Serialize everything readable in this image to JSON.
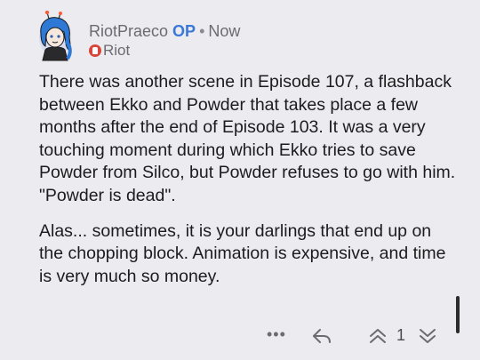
{
  "comment": {
    "author": "RiotPraeco",
    "op_badge": "OP",
    "separator": "•",
    "timestamp": "Now",
    "flair": "Riot",
    "paragraphs": [
      "There was another scene in Episode 107, a flashback between Ekko and Powder that takes place a few months after the end of Episode 103. It was a very touching moment during which Ekko tries to save Powder from Silco, but Powder refuses to go with him. \"Powder is dead\".",
      "Alas... sometimes, it is your darlings that end up on the chopping block. Animation is expensive, and time is very much so money."
    ],
    "score": "1"
  },
  "actions": {
    "more": "•••",
    "icons": [
      "more-icon",
      "reply-icon",
      "upvote-icon",
      "downvote-icon"
    ]
  },
  "colors": {
    "background": "#ebebf0",
    "op_badge": "#3a78d8",
    "flair_icon": "#d8453a",
    "text": "#1c1c1e"
  }
}
